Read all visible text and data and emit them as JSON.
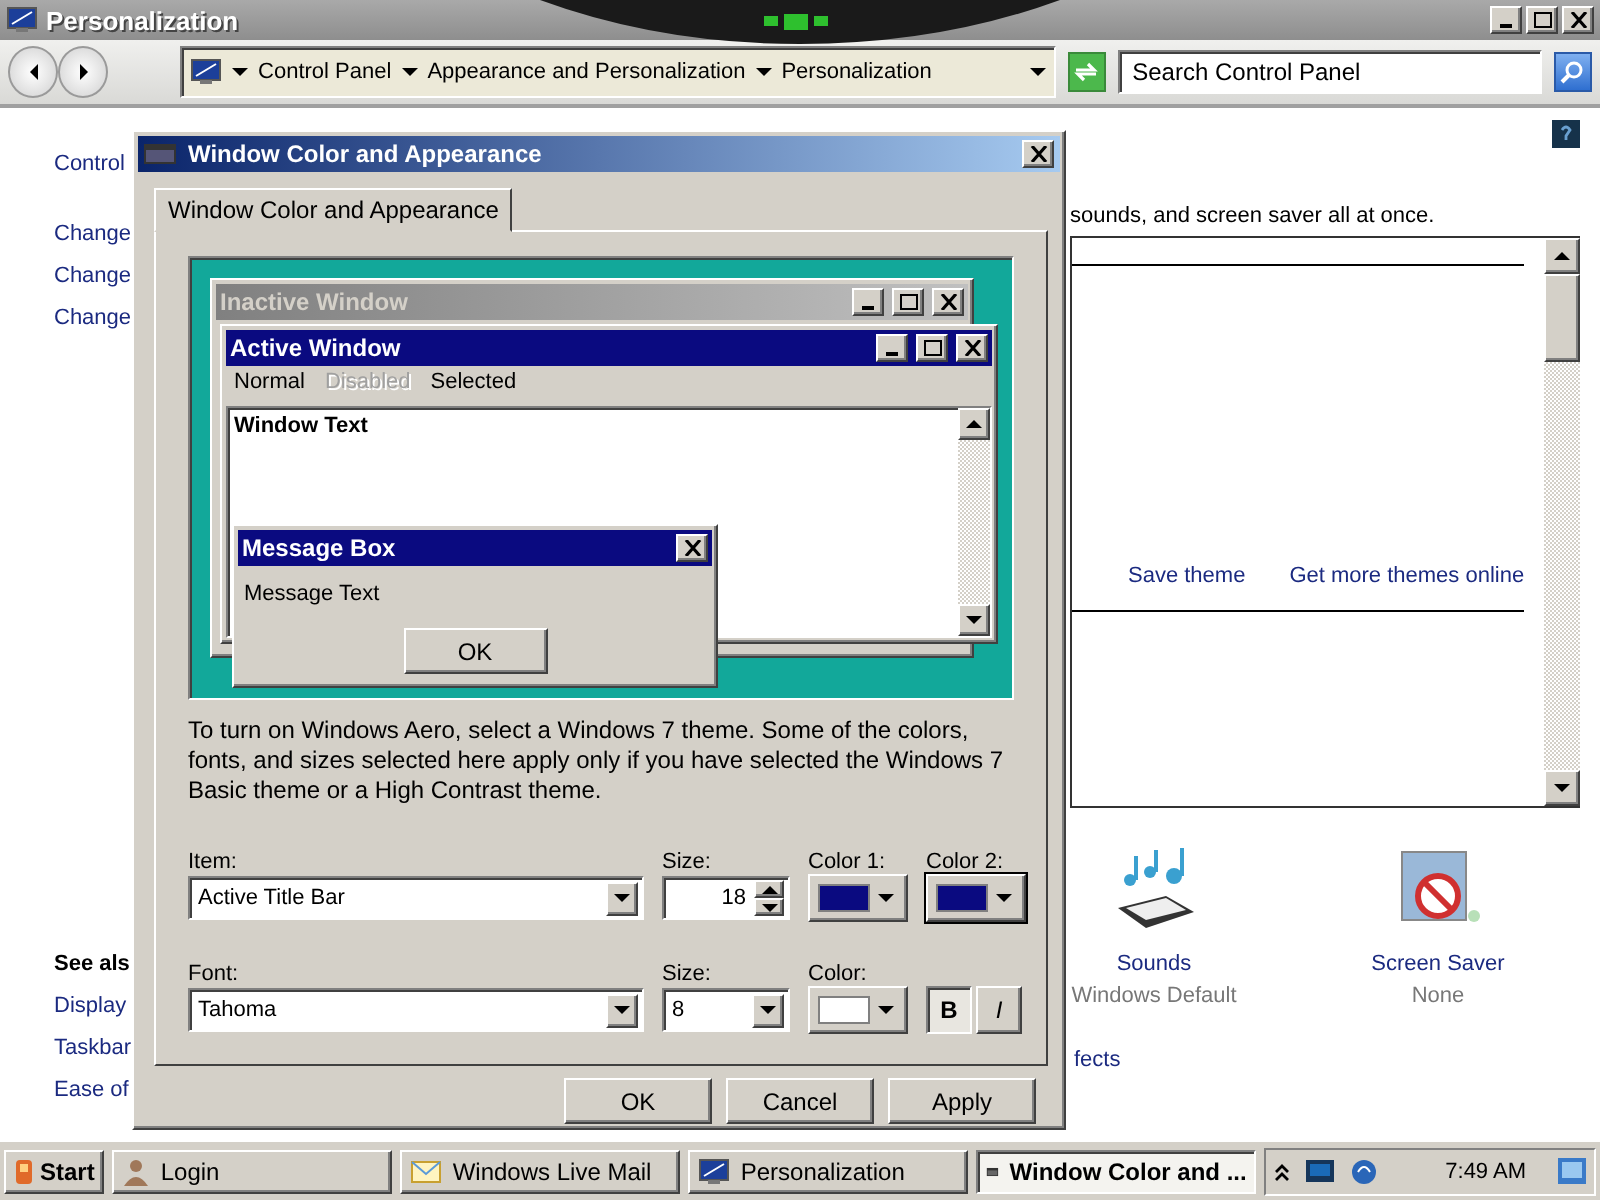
{
  "window": {
    "title": "Personalization"
  },
  "address_bar": {
    "breadcrumbs": [
      "Control Panel",
      "Appearance and Personalization",
      "Personalization"
    ],
    "search_placeholder": "Search Control Panel"
  },
  "left_pane": {
    "links": [
      "Control",
      "Change",
      "Change",
      "Change"
    ],
    "see_also_heading": "See als",
    "see_also": [
      "Display",
      "Taskbar",
      "Ease of"
    ]
  },
  "content": {
    "intro": "sounds, and screen saver all at once.",
    "theme_actions": [
      "Save theme",
      "Get more themes online"
    ],
    "settings": [
      {
        "kind": "sounds",
        "label": "Sounds",
        "value": "Windows Default"
      },
      {
        "kind": "screensaver",
        "label": "Screen Saver",
        "value": "None"
      }
    ],
    "footer_link": "fects"
  },
  "dialog": {
    "title": "Window Color and Appearance",
    "tabs": [
      {
        "label": "Window Color and Appearance",
        "selected": true
      }
    ],
    "preview": {
      "inactive_title": "Inactive Window",
      "active_title": "Active Window",
      "menu": [
        {
          "label": "Normal",
          "disabled": false
        },
        {
          "label": "Disabled",
          "disabled": true
        },
        {
          "label": "Selected",
          "disabled": false
        }
      ],
      "window_text": "Window Text",
      "message_title": "Message Box",
      "message_text": "Message Text",
      "message_button": "OK"
    },
    "note": "To turn on Windows Aero, select a Windows 7 theme.  Some of the colors, fonts, and sizes selected here apply only if you have selected the Windows 7 Basic theme or a High Contrast theme.",
    "item": {
      "label": "Item:",
      "value": "Active Title Bar"
    },
    "item_size": {
      "label": "Size:",
      "value": "18"
    },
    "color1": {
      "label": "Color 1:",
      "color": "#0a0a80"
    },
    "color2": {
      "label": "Color 2:",
      "color": "#0a0a80"
    },
    "font": {
      "label": "Font:",
      "value": "Tahoma"
    },
    "font_size": {
      "label": "Size:",
      "value": "8"
    },
    "font_color": {
      "label": "Color:",
      "color": "#ffffff"
    },
    "bold": {
      "label": "B",
      "on": true
    },
    "italic": {
      "label": "I",
      "on": false
    },
    "buttons": [
      "OK",
      "Cancel",
      "Apply"
    ]
  },
  "taskbar": {
    "start": "Start",
    "tasks": [
      {
        "label": "Login",
        "selected": false
      },
      {
        "label": "Windows Live Mail",
        "selected": false
      },
      {
        "label": "Personalization",
        "selected": false
      },
      {
        "label": "Window Color and ...",
        "selected": true
      }
    ],
    "clock": "7:49 AM"
  }
}
